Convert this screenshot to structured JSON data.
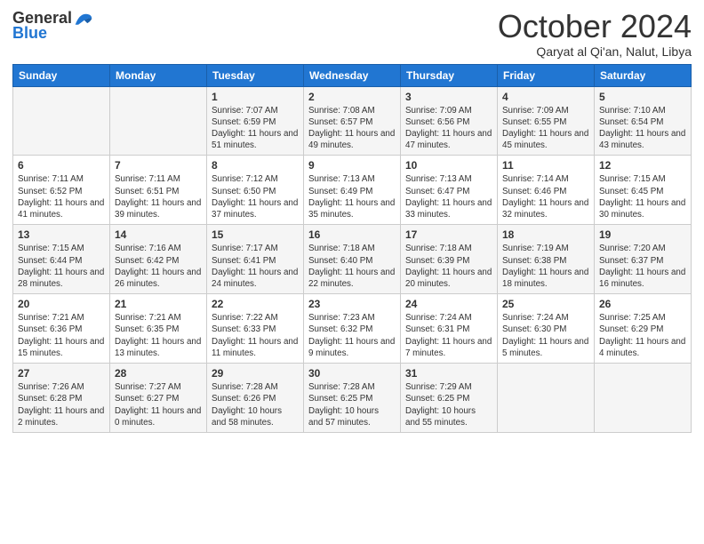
{
  "header": {
    "logo_general": "General",
    "logo_blue": "Blue",
    "month_title": "October 2024",
    "location": "Qaryat al Qi'an, Nalut, Libya"
  },
  "days_of_week": [
    "Sunday",
    "Monday",
    "Tuesday",
    "Wednesday",
    "Thursday",
    "Friday",
    "Saturday"
  ],
  "weeks": [
    [
      {
        "day": "",
        "info": ""
      },
      {
        "day": "",
        "info": ""
      },
      {
        "day": "1",
        "info": "Sunrise: 7:07 AM\nSunset: 6:59 PM\nDaylight: 11 hours and 51 minutes."
      },
      {
        "day": "2",
        "info": "Sunrise: 7:08 AM\nSunset: 6:57 PM\nDaylight: 11 hours and 49 minutes."
      },
      {
        "day": "3",
        "info": "Sunrise: 7:09 AM\nSunset: 6:56 PM\nDaylight: 11 hours and 47 minutes."
      },
      {
        "day": "4",
        "info": "Sunrise: 7:09 AM\nSunset: 6:55 PM\nDaylight: 11 hours and 45 minutes."
      },
      {
        "day": "5",
        "info": "Sunrise: 7:10 AM\nSunset: 6:54 PM\nDaylight: 11 hours and 43 minutes."
      }
    ],
    [
      {
        "day": "6",
        "info": "Sunrise: 7:11 AM\nSunset: 6:52 PM\nDaylight: 11 hours and 41 minutes."
      },
      {
        "day": "7",
        "info": "Sunrise: 7:11 AM\nSunset: 6:51 PM\nDaylight: 11 hours and 39 minutes."
      },
      {
        "day": "8",
        "info": "Sunrise: 7:12 AM\nSunset: 6:50 PM\nDaylight: 11 hours and 37 minutes."
      },
      {
        "day": "9",
        "info": "Sunrise: 7:13 AM\nSunset: 6:49 PM\nDaylight: 11 hours and 35 minutes."
      },
      {
        "day": "10",
        "info": "Sunrise: 7:13 AM\nSunset: 6:47 PM\nDaylight: 11 hours and 33 minutes."
      },
      {
        "day": "11",
        "info": "Sunrise: 7:14 AM\nSunset: 6:46 PM\nDaylight: 11 hours and 32 minutes."
      },
      {
        "day": "12",
        "info": "Sunrise: 7:15 AM\nSunset: 6:45 PM\nDaylight: 11 hours and 30 minutes."
      }
    ],
    [
      {
        "day": "13",
        "info": "Sunrise: 7:15 AM\nSunset: 6:44 PM\nDaylight: 11 hours and 28 minutes."
      },
      {
        "day": "14",
        "info": "Sunrise: 7:16 AM\nSunset: 6:42 PM\nDaylight: 11 hours and 26 minutes."
      },
      {
        "day": "15",
        "info": "Sunrise: 7:17 AM\nSunset: 6:41 PM\nDaylight: 11 hours and 24 minutes."
      },
      {
        "day": "16",
        "info": "Sunrise: 7:18 AM\nSunset: 6:40 PM\nDaylight: 11 hours and 22 minutes."
      },
      {
        "day": "17",
        "info": "Sunrise: 7:18 AM\nSunset: 6:39 PM\nDaylight: 11 hours and 20 minutes."
      },
      {
        "day": "18",
        "info": "Sunrise: 7:19 AM\nSunset: 6:38 PM\nDaylight: 11 hours and 18 minutes."
      },
      {
        "day": "19",
        "info": "Sunrise: 7:20 AM\nSunset: 6:37 PM\nDaylight: 11 hours and 16 minutes."
      }
    ],
    [
      {
        "day": "20",
        "info": "Sunrise: 7:21 AM\nSunset: 6:36 PM\nDaylight: 11 hours and 15 minutes."
      },
      {
        "day": "21",
        "info": "Sunrise: 7:21 AM\nSunset: 6:35 PM\nDaylight: 11 hours and 13 minutes."
      },
      {
        "day": "22",
        "info": "Sunrise: 7:22 AM\nSunset: 6:33 PM\nDaylight: 11 hours and 11 minutes."
      },
      {
        "day": "23",
        "info": "Sunrise: 7:23 AM\nSunset: 6:32 PM\nDaylight: 11 hours and 9 minutes."
      },
      {
        "day": "24",
        "info": "Sunrise: 7:24 AM\nSunset: 6:31 PM\nDaylight: 11 hours and 7 minutes."
      },
      {
        "day": "25",
        "info": "Sunrise: 7:24 AM\nSunset: 6:30 PM\nDaylight: 11 hours and 5 minutes."
      },
      {
        "day": "26",
        "info": "Sunrise: 7:25 AM\nSunset: 6:29 PM\nDaylight: 11 hours and 4 minutes."
      }
    ],
    [
      {
        "day": "27",
        "info": "Sunrise: 7:26 AM\nSunset: 6:28 PM\nDaylight: 11 hours and 2 minutes."
      },
      {
        "day": "28",
        "info": "Sunrise: 7:27 AM\nSunset: 6:27 PM\nDaylight: 11 hours and 0 minutes."
      },
      {
        "day": "29",
        "info": "Sunrise: 7:28 AM\nSunset: 6:26 PM\nDaylight: 10 hours and 58 minutes."
      },
      {
        "day": "30",
        "info": "Sunrise: 7:28 AM\nSunset: 6:25 PM\nDaylight: 10 hours and 57 minutes."
      },
      {
        "day": "31",
        "info": "Sunrise: 7:29 AM\nSunset: 6:25 PM\nDaylight: 10 hours and 55 minutes."
      },
      {
        "day": "",
        "info": ""
      },
      {
        "day": "",
        "info": ""
      }
    ]
  ]
}
